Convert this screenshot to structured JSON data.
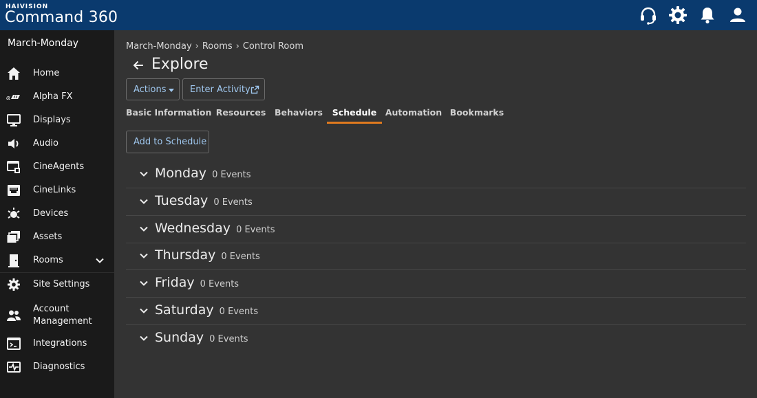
{
  "header": {
    "brand_top": "HAIVISION",
    "brand_main": "Command 360",
    "icons": [
      "headset-icon",
      "gear-icon",
      "bell-icon",
      "user-icon"
    ]
  },
  "sidebar": {
    "site_name": "March-Monday",
    "items": [
      {
        "label": "Home",
        "icon": "home-icon"
      },
      {
        "label": "Alpha FX",
        "icon": "alphafx-icon"
      },
      {
        "label": "Displays",
        "icon": "monitor-icon"
      },
      {
        "label": "Audio",
        "icon": "speaker-icon"
      },
      {
        "label": "CineAgents",
        "icon": "cineagents-icon"
      },
      {
        "label": "CineLinks",
        "icon": "cinelinks-icon"
      },
      {
        "label": "Devices",
        "icon": "devices-icon"
      },
      {
        "label": "Assets",
        "icon": "assets-icon"
      },
      {
        "label": "Rooms",
        "icon": "door-icon"
      },
      {
        "label": "Site Settings",
        "icon": "gear-icon"
      },
      {
        "label": "Account Management",
        "icon": "users-icon"
      },
      {
        "label": "Integrations",
        "icon": "terminal-icon"
      },
      {
        "label": "Diagnostics",
        "icon": "pulse-icon"
      }
    ]
  },
  "breadcrumb": [
    "March-Monday",
    "Rooms",
    "Control Room"
  ],
  "page_title": "Explore",
  "buttons": {
    "actions": "Actions",
    "enter_activity": "Enter Activity",
    "add_to_schedule": "Add to Schedule"
  },
  "tabs": [
    {
      "label": "Basic Information",
      "active": false
    },
    {
      "label": "Resources",
      "active": false
    },
    {
      "label": "Behaviors",
      "active": false
    },
    {
      "label": "Schedule",
      "active": true
    },
    {
      "label": "Automation",
      "active": false
    },
    {
      "label": "Bookmarks",
      "active": false
    }
  ],
  "schedule": [
    {
      "day": "Monday",
      "events": "0 Events"
    },
    {
      "day": "Tuesday",
      "events": "0 Events"
    },
    {
      "day": "Wednesday",
      "events": "0 Events"
    },
    {
      "day": "Thursday",
      "events": "0 Events"
    },
    {
      "day": "Friday",
      "events": "0 Events"
    },
    {
      "day": "Saturday",
      "events": "0 Events"
    },
    {
      "day": "Sunday",
      "events": "0 Events"
    }
  ],
  "colors": {
    "header_bg": "#0a3a6e",
    "sidebar_bg": "#1a1a1a",
    "main_bg": "#333333",
    "accent": "#e07a1f",
    "link_blue": "#9fc7ee"
  }
}
